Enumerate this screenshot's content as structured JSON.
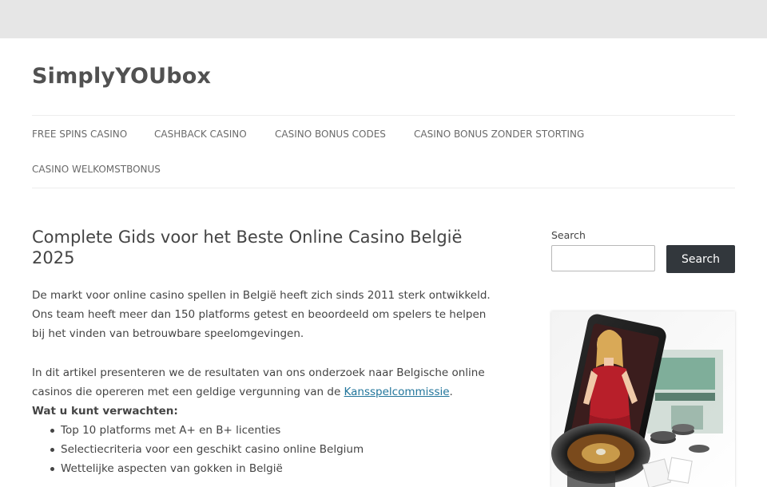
{
  "site": {
    "title": "SimplyYOUbox"
  },
  "nav": {
    "items": [
      {
        "label": "FREE SPINS CASINO"
      },
      {
        "label": "CASHBACK CASINO"
      },
      {
        "label": "CASINO BONUS CODES"
      },
      {
        "label": "CASINO BONUS ZONDER STORTING"
      },
      {
        "label": "CASINO WELKOMSTBONUS"
      }
    ]
  },
  "article": {
    "title": "Complete Gids voor het Beste Online Casino België 2025",
    "intro": "De markt voor online casino spellen in België heeft zich sinds 2011 sterk ontwikkeld. Ons team heeft meer dan 150 platforms getest en beoordeeld om spelers te helpen bij het vinden van betrouwbare speelomgevingen.",
    "para2_before": "In dit artikel presenteren we de resultaten van ons onderzoek naar Belgische online casinos die opereren met een geldige vergunning van de ",
    "para2_link": "Kansspelcommissie",
    "para2_after": ".",
    "expect_heading": "Wat u kunt verwachten:",
    "bullets": [
      "Top 10 platforms met A+ en B+ licenties",
      "Selectiecriteria voor een geschikt casino online Belgium",
      "Wettelijke aspecten van gokken in België"
    ]
  },
  "sidebar": {
    "search_label": "Search",
    "search_placeholder": "",
    "search_button": "Search"
  },
  "colors": {
    "topbar": "#e6e6e6",
    "link": "#21759b",
    "button": "#32373c"
  }
}
